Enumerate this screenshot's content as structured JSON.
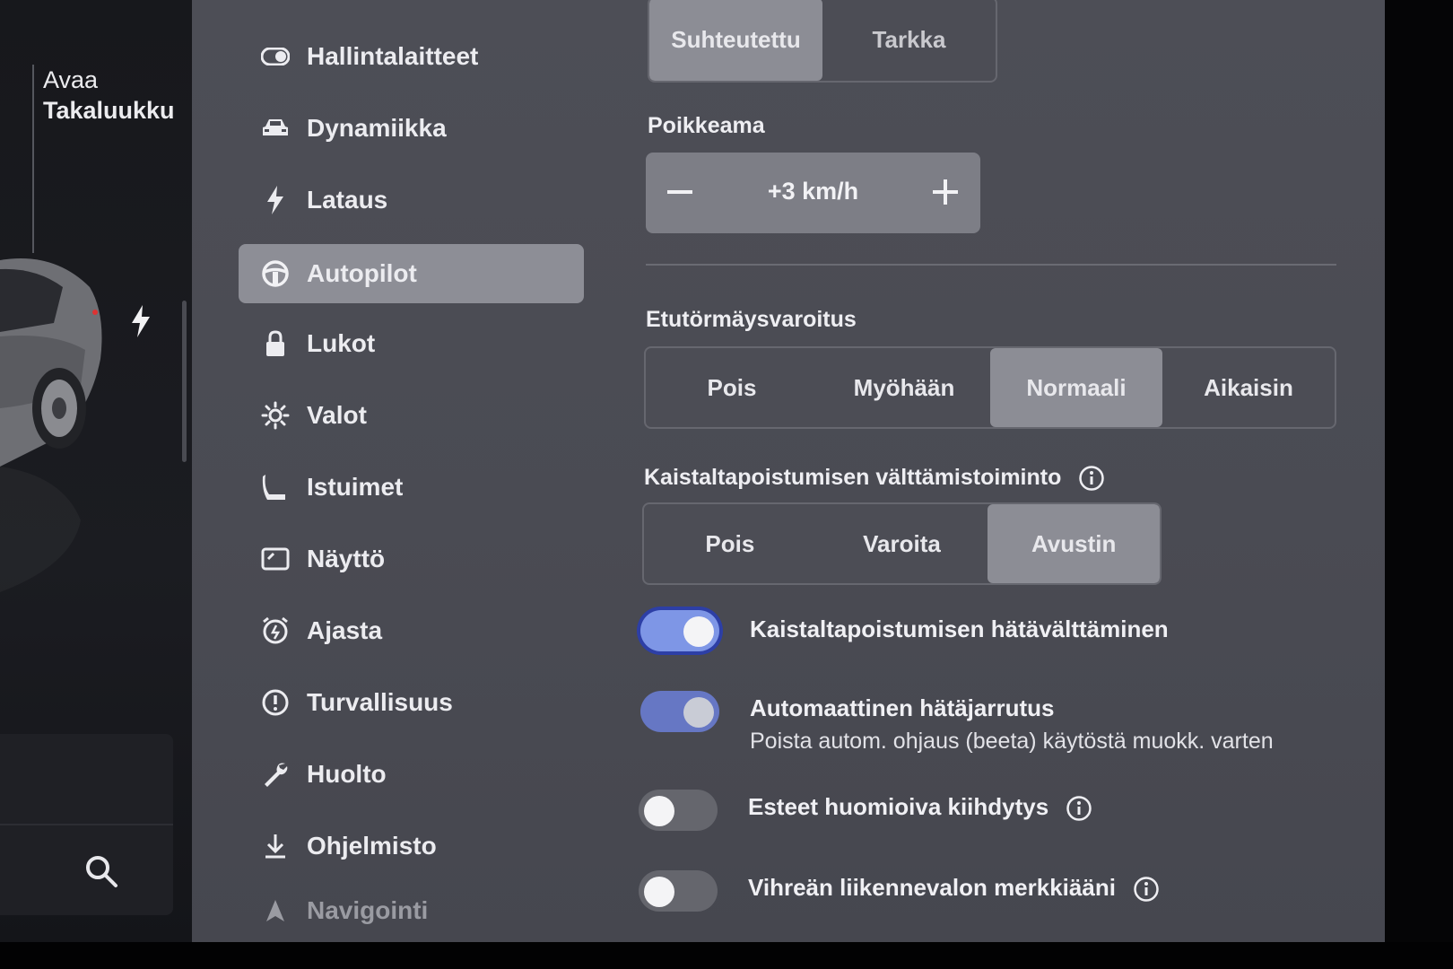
{
  "left_panel": {
    "trunk_line1": "Avaa",
    "trunk_line2": "Takaluukku"
  },
  "menu": [
    {
      "label": "Hallintalaitteet",
      "icon": "toggle-icon"
    },
    {
      "label": "Dynamiikka",
      "icon": "car-icon"
    },
    {
      "label": "Lataus",
      "icon": "bolt-icon"
    },
    {
      "label": "Autopilot",
      "icon": "steering-wheel-icon",
      "active": true
    },
    {
      "label": "Lukot",
      "icon": "lock-icon"
    },
    {
      "label": "Valot",
      "icon": "sun-icon"
    },
    {
      "label": "Istuimet",
      "icon": "seat-icon"
    },
    {
      "label": "Näyttö",
      "icon": "display-icon"
    },
    {
      "label": "Ajasta",
      "icon": "alarm-clock-icon"
    },
    {
      "label": "Turvallisuus",
      "icon": "alert-circle-icon"
    },
    {
      "label": "Huolto",
      "icon": "wrench-icon"
    },
    {
      "label": "Ohjelmisto",
      "icon": "download-icon"
    },
    {
      "label": "Navigointi",
      "icon": "navigation-arrow-icon"
    }
  ],
  "speed_mode": {
    "options": [
      "Suhteutettu",
      "Tarkka"
    ],
    "selected": "Suhteutettu"
  },
  "offset": {
    "title": "Poikkeama",
    "value": "+3 km/h"
  },
  "forward_collision": {
    "title": "Etutörmäysvaroitus",
    "options": [
      "Pois",
      "Myöhään",
      "Normaali",
      "Aikaisin"
    ],
    "selected": "Normaali"
  },
  "lane_departure": {
    "title": "Kaistaltapoistumisen välttämistoiminto",
    "options": [
      "Pois",
      "Varoita",
      "Avustin"
    ],
    "selected": "Avustin"
  },
  "toggles": [
    {
      "label": "Kaistaltapoistumisen hätävälttäminen",
      "state": "on"
    },
    {
      "label": "Automaattinen hätäjarrutus",
      "sublabel": "Poista autom. ohjaus (beeta) käytöstä muokk. varten",
      "state": "on"
    },
    {
      "label": "Esteet huomioiva kiihdytys",
      "state": "off"
    },
    {
      "label": "Vihreän liikennevalon merkkiääni",
      "state": "off"
    }
  ],
  "colors": {
    "toggle_on": "#7e96e6",
    "selected_segment": "#8c8d95",
    "surface": "#4b4c54"
  }
}
